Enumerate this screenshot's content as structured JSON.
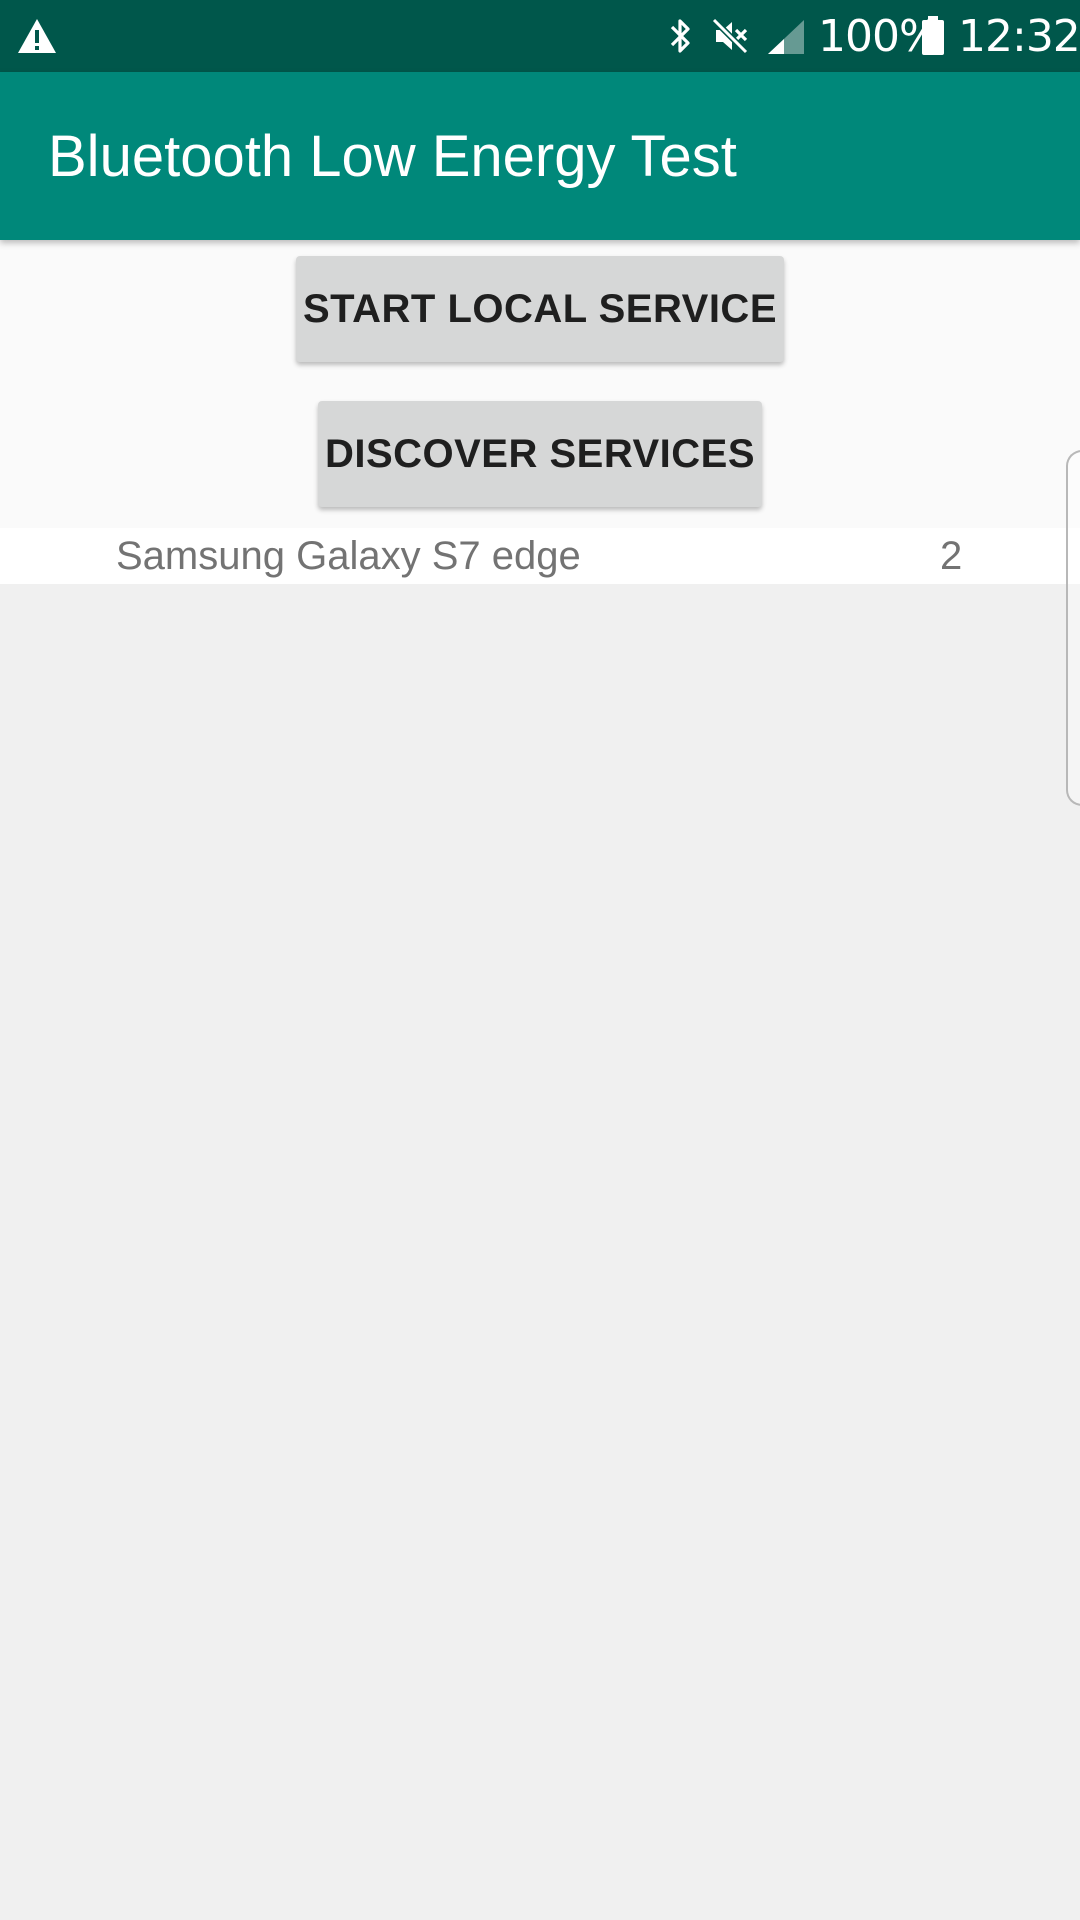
{
  "status_bar": {
    "warning_icon": "warning-icon",
    "bluetooth_icon": "bluetooth-icon",
    "mute_icon": "volume-mute-icon",
    "signal_icon": "signal-icon",
    "battery_percent": "100%",
    "battery_icon": "battery-icon",
    "time": "12:32"
  },
  "app_bar": {
    "title": "Bluetooth Low Energy Test",
    "color": "#00887a",
    "status_bar_color": "#00574b"
  },
  "actions": {
    "start_local_service_label": "START LOCAL SERVICE",
    "discover_services_label": "DISCOVER SERVICES"
  },
  "devices": [
    {
      "name": "Samsung Galaxy S7 edge",
      "count": "2"
    }
  ]
}
